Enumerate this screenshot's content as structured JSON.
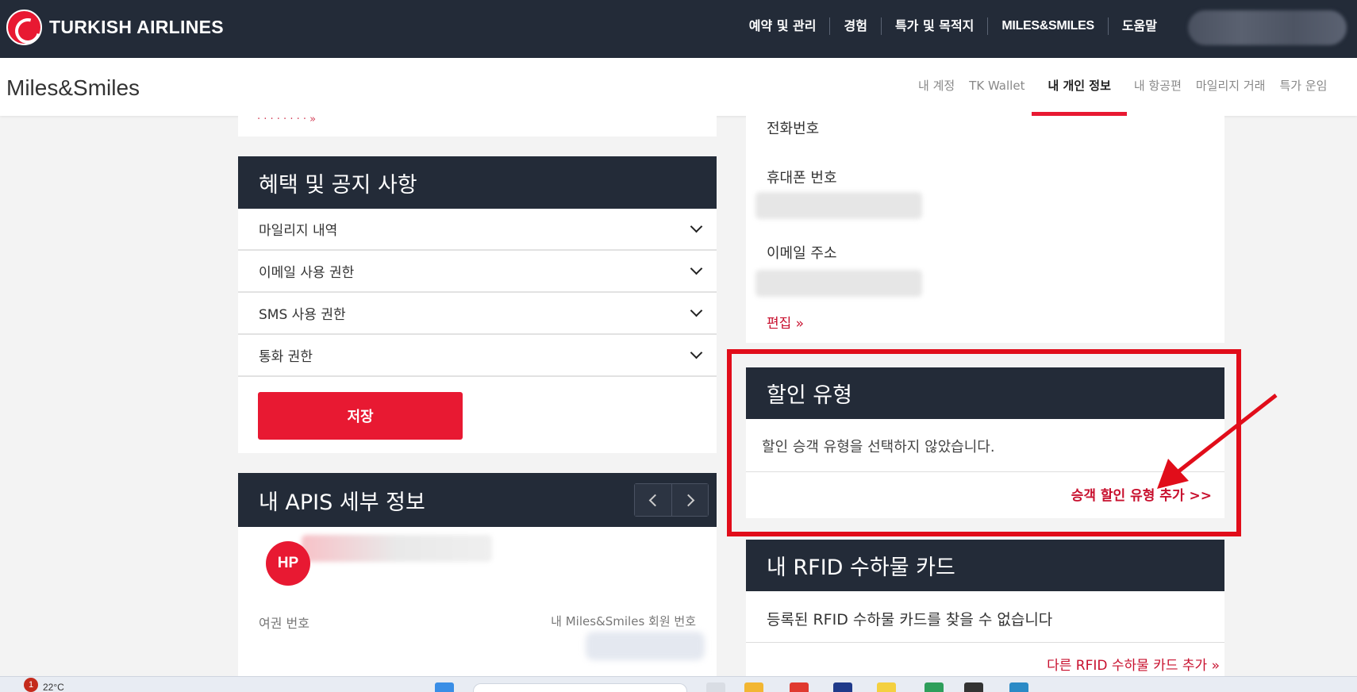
{
  "topbar": {
    "brand": "TURKISH AIRLINES",
    "nav": [
      "예약 및 관리",
      "경험",
      "특가 및 목적지",
      "MILES&SMILES",
      "도움말"
    ]
  },
  "subbar": {
    "title": "Miles&Smiles",
    "nav": [
      "내 계정",
      "TK Wallet",
      "내 개인 정보",
      "내 항공편",
      "마일리지 거래",
      "특가 운임"
    ],
    "active_index": 2
  },
  "notices": {
    "title": "혜택 및 공지 사항",
    "items": [
      "마일리지 내역",
      "이메일 사용 권한",
      "SMS 사용 권한",
      "통화 권한"
    ],
    "save_label": "저장"
  },
  "apis": {
    "title": "내 APIS 세부 정보",
    "avatar_initials": "HP",
    "passport_label": "여권 번호",
    "member_label": "내 Miles&Smiles 회원 번호"
  },
  "contact": {
    "phone_label": "전화번호",
    "mobile_label": "휴대폰 번호",
    "email_label": "이메일 주소",
    "edit_link": "편집 »"
  },
  "discount": {
    "title": "할인 유형",
    "message": "할인 승객 유형을 선택하지 않았습니다.",
    "add_link": "승객 할인 유형 추가 >>"
  },
  "rfid": {
    "title": "내 RFID 수하물 카드",
    "message": "등록된 RFID 수하물 카드를 찾을 수 없습니다",
    "add_link": "다른 RFID 수하물 카드 추가 »"
  },
  "taskbar": {
    "notification_count": "1",
    "temperature": "22°C"
  },
  "colors": {
    "navy": "#232b38",
    "brand_red": "#e81932",
    "highlight_red": "#e10d1a"
  }
}
